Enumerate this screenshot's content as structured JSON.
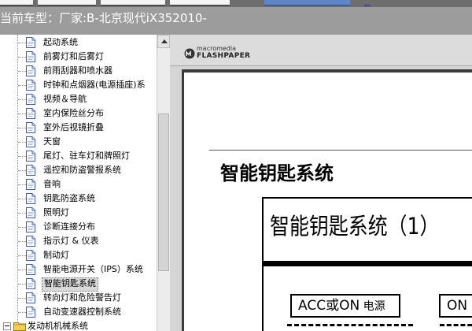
{
  "header": {
    "car_title": "当前车型：厂家:B-北京现代iX352010-",
    "top_link": "..."
  },
  "tree": {
    "items": [
      {
        "label": "起动系统"
      },
      {
        "label": "前雾灯和后雾灯"
      },
      {
        "label": "前雨刮器和喷水器"
      },
      {
        "label": "时钟和点烟器(电源插座)系"
      },
      {
        "label": "视频＆导航"
      },
      {
        "label": "室内保险丝分布"
      },
      {
        "label": "室外后视镜折叠"
      },
      {
        "label": "天窗"
      },
      {
        "label": "尾灯、驻车灯和牌照灯"
      },
      {
        "label": "遥控和防盗警报系统"
      },
      {
        "label": "音响"
      },
      {
        "label": "钥匙防盗系统"
      },
      {
        "label": "照明灯"
      },
      {
        "label": "诊断连接分布"
      },
      {
        "label": "指示灯 & 仪表"
      },
      {
        "label": "制动灯"
      },
      {
        "label": "智能电源开关（IPS）系统"
      },
      {
        "label": "智能钥匙系统",
        "selected": true
      },
      {
        "label": "转向灯和危险警告灯"
      },
      {
        "label": "自动变速器控制系统"
      }
    ],
    "folder": {
      "label": "发动机机械系统"
    }
  },
  "viewer": {
    "brand_line1": "macromedia",
    "brand_line2": "FLASHPAPER",
    "page_title": "智能钥匙系统",
    "diagram_title": "智能钥匙系统（1）",
    "box_acc_main": "ACC或ON",
    "box_acc_sub": "电源",
    "box_on": "ON 电"
  },
  "colors": {
    "header_bg": "#9c9c9c",
    "selection_bg": "#d9d9d9",
    "viewer_bg": "#d5d5d5"
  }
}
